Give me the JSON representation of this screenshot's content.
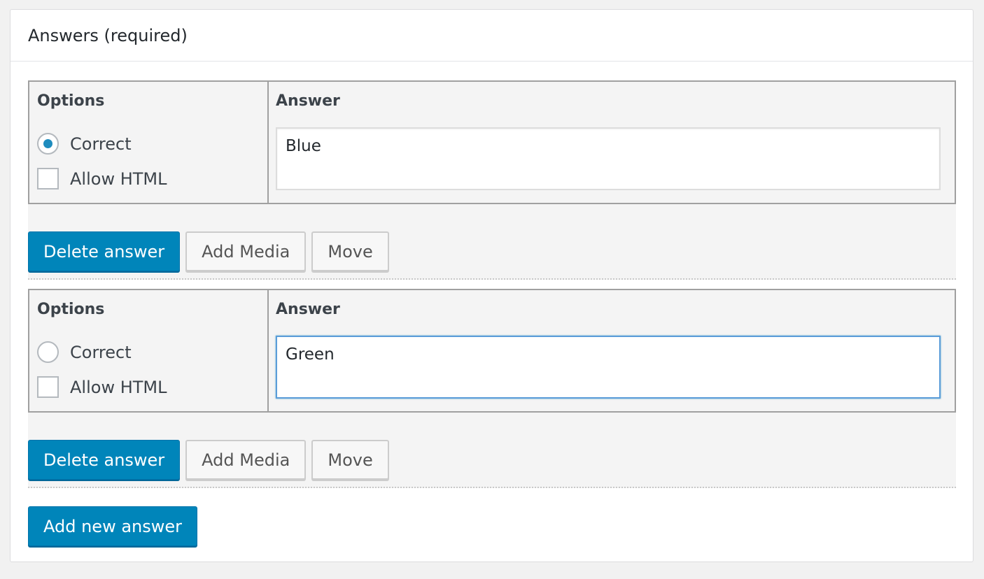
{
  "panel": {
    "title": "Answers (required)"
  },
  "answers": [
    {
      "options_header": "Options",
      "answer_header": "Answer",
      "correct_label": "Correct",
      "correct_checked": true,
      "allow_html_label": "Allow HTML",
      "allow_html_checked": false,
      "value": "Blue",
      "focused": false,
      "delete_label": "Delete answer",
      "add_media_label": "Add Media",
      "move_label": "Move"
    },
    {
      "options_header": "Options",
      "answer_header": "Answer",
      "correct_label": "Correct",
      "correct_checked": false,
      "allow_html_label": "Allow HTML",
      "allow_html_checked": false,
      "value": "Green",
      "focused": true,
      "delete_label": "Delete answer",
      "add_media_label": "Add Media",
      "move_label": "Move"
    }
  ],
  "add_new_label": "Add new answer",
  "colors": {
    "primary": "#0085ba",
    "focus": "#5b9dd9",
    "radio_dot": "#1e8cbe"
  }
}
